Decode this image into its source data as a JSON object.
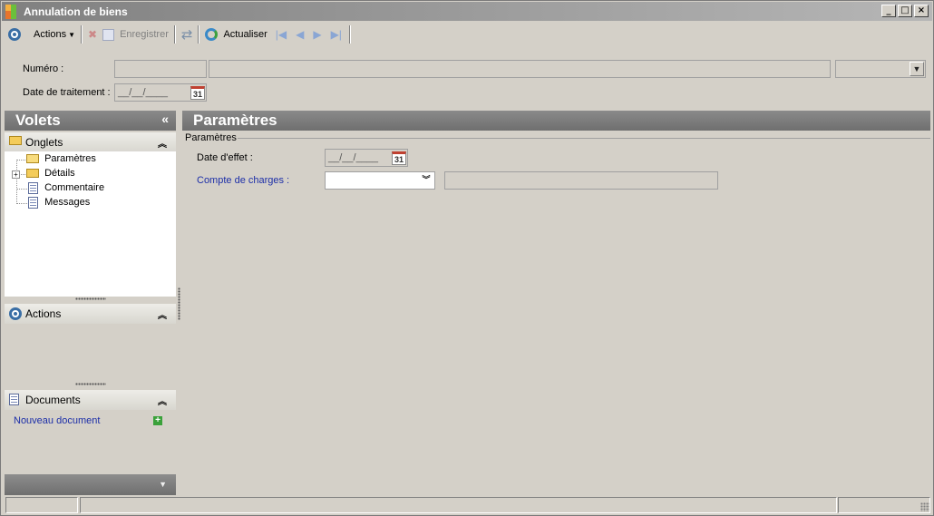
{
  "window": {
    "title": "Annulation de biens",
    "controls": [
      "minimize-icon",
      "maximize-icon",
      "close-icon"
    ]
  },
  "toolbar": {
    "actions_label": "Actions",
    "save_label": "Enregistrer",
    "refresh_label": "Actualiser"
  },
  "header": {
    "numero_label": "Numéro :",
    "numero_value": "",
    "numero_desc": "",
    "numero_select": "",
    "date_traitement_label": "Date de traitement :",
    "date_traitement_mask": "__/__/____",
    "calendar_glyph": "31"
  },
  "left_pane": {
    "title": "Volets",
    "collapse_glyph": "«",
    "onglets": {
      "title": "Onglets",
      "items": [
        {
          "label": "Paramètres",
          "icon": "folder-open-icon",
          "selected": true
        },
        {
          "label": "Détails",
          "icon": "folder-icon",
          "expandable": true
        },
        {
          "label": "Commentaire",
          "icon": "document-icon"
        },
        {
          "label": "Messages",
          "icon": "document-icon"
        }
      ]
    },
    "actions": {
      "title": "Actions"
    },
    "documents": {
      "title": "Documents",
      "new_document": "Nouveau document"
    }
  },
  "main": {
    "title": "Paramètres",
    "group_title": "Paramètres",
    "date_effet_label": "Date d'effet :",
    "date_effet_mask": "__/__/____",
    "compte_label": "Compte de charges :",
    "compte_value": "",
    "compte_desc": ""
  },
  "colors": {
    "header_gray": "#7a7a7a",
    "link_blue": "#1d2fa8",
    "window_bg": "#d4d0c8"
  }
}
